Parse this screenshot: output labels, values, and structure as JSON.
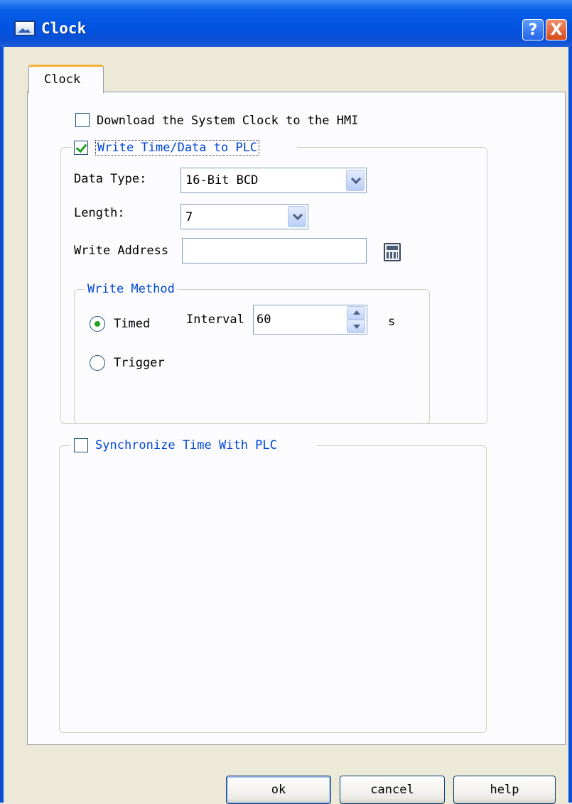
{
  "window": {
    "title": "Clock"
  },
  "titlebar_buttons": {
    "help": "?",
    "close": "X"
  },
  "tab": {
    "label": "Clock"
  },
  "download_clock": {
    "label": "Download the System Clock to the HMI",
    "checked": false
  },
  "write_time": {
    "label": "Write Time/Data to PLC",
    "checked": true,
    "data_type": {
      "label": "Data Type:",
      "value": "16-Bit BCD"
    },
    "length": {
      "label": "Length:",
      "value": "7"
    },
    "write_address": {
      "label": "Write Address",
      "value": ""
    },
    "write_method": {
      "legend": "Write Method",
      "timed": {
        "label": "Timed",
        "selected": true
      },
      "trigger": {
        "label": "Trigger",
        "selected": false
      },
      "interval": {
        "label": "Interval",
        "value": "60",
        "unit": "s"
      }
    }
  },
  "sync_time": {
    "label": "Synchronize Time With PLC",
    "checked": false
  },
  "buttons": {
    "ok": "ok",
    "cancel": "cancel",
    "help": "help"
  },
  "colors": {
    "titlebar": "#0054e3",
    "group_text": "#0046d5",
    "check_mark": "#21a121",
    "tab_accent": "#f7b23a"
  }
}
